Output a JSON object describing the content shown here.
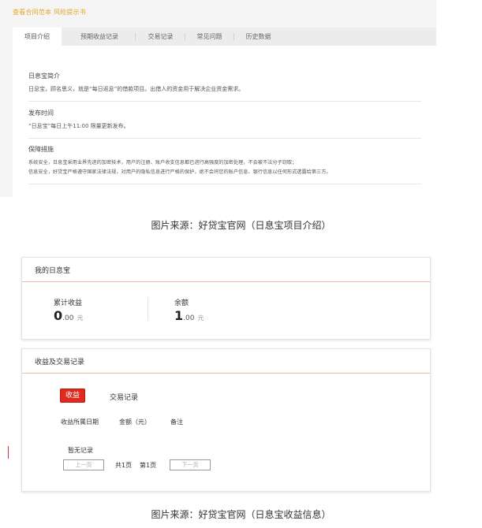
{
  "shot1": {
    "top_links": "查看合同范本  风险提示书",
    "tabs": [
      "项目介绍",
      "预期收益记录",
      "交易记录",
      "常见问题",
      "历史数据"
    ],
    "sections": {
      "intro_title": "日息宝简介",
      "intro_text": "日息宝，顾名思义，就是“每日返息”的借款项目。出借人的资金用于解决企业资金需求。",
      "release_title": "发布时间",
      "release_text": "“日息宝”每日上午11:00 限量更新发布。",
      "security_title": "保障措施",
      "security_text_1": "系统安全，日息宝采用业界先进的加密技术，用户的注册、账户收支信息都已进行高强度的加密处理，不会被不法分子窃取；",
      "security_text_2": "信息安全，好贷宝严格遵守国家法律法规，对用户的隐私信息进行严格的保护，绝不会将您的账户信息、银行信息以任何形式透露给第三方。"
    }
  },
  "caption1": "图片来源：好贷宝官网（日息宝项目介绍）",
  "card1": {
    "title": "我的日息宝",
    "total_income_label": "累计收益",
    "total_income_int": "0",
    "total_income_dec": ".00",
    "balance_label": "余额",
    "balance_int": "1",
    "balance_dec": ".00",
    "unit": "元"
  },
  "card2": {
    "title": "收益及交易记录",
    "tab_income": "收益",
    "tab_trade": "交易记录",
    "columns": [
      "收益所属日期",
      "金额（元）",
      "备注"
    ],
    "empty_text": "暂无记录",
    "prev_label": "上一页",
    "total_pages": "共1页",
    "current_page": "第1页",
    "next_label": "下一页"
  },
  "caption2": "图片来源：好贷宝官网（日息宝收益信息）",
  "colors": {
    "accent_red": "#e02a1e",
    "link_orange": "#e8a42c",
    "divider_pink": "#f0b6a8"
  }
}
